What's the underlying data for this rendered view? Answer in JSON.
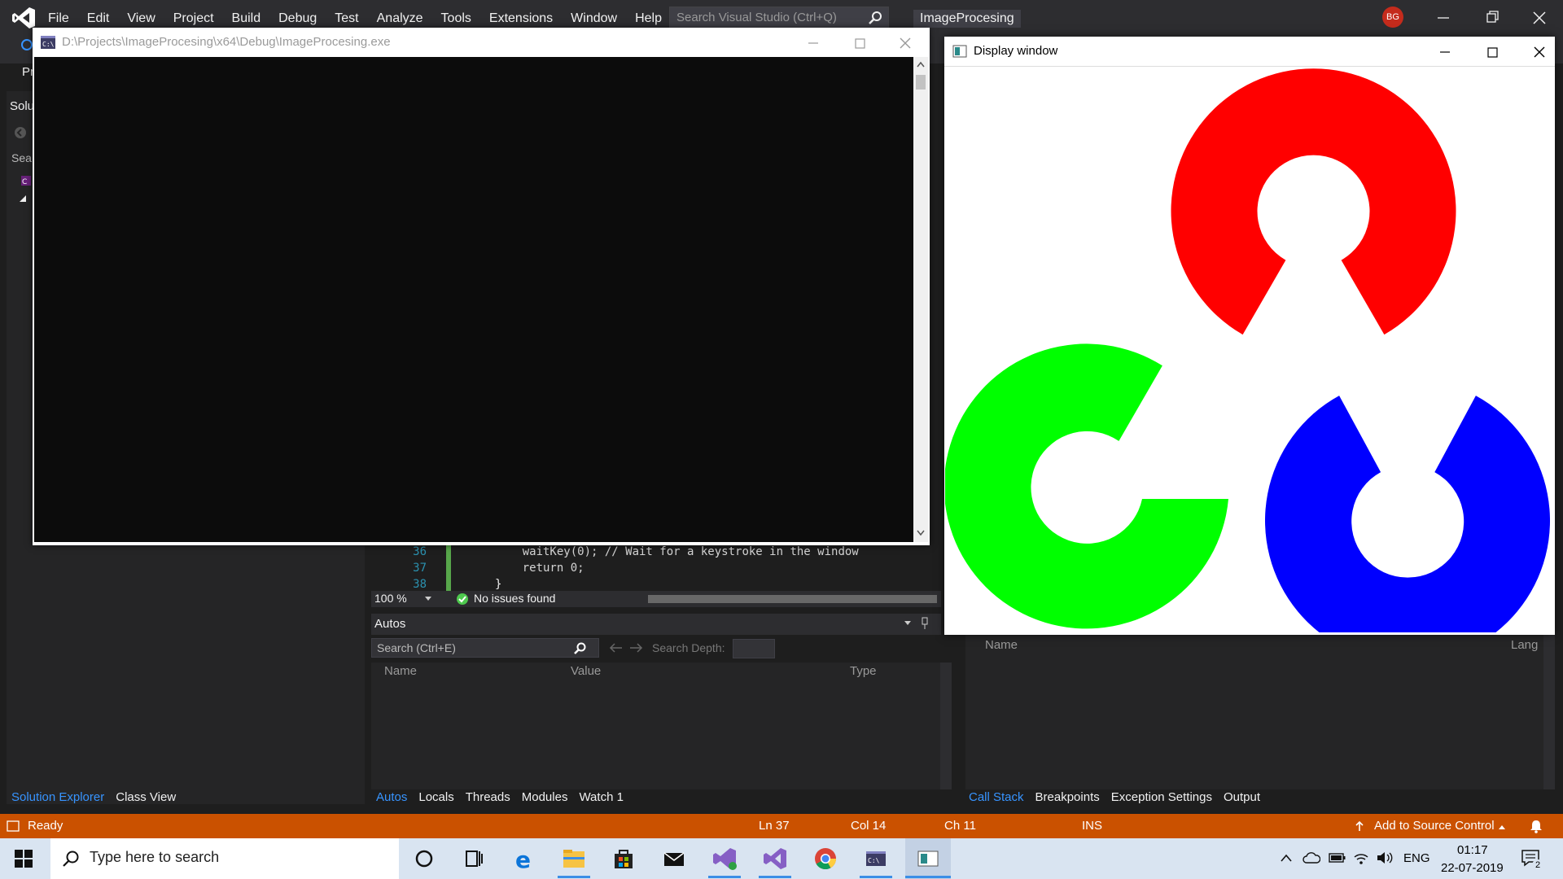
{
  "vs": {
    "menu": [
      "File",
      "Edit",
      "View",
      "Project",
      "Build",
      "Debug",
      "Test",
      "Analyze",
      "Tools",
      "Extensions",
      "Window",
      "Help"
    ],
    "search_placeholder": "Search Visual Studio (Ctrl+Q)",
    "project_title": "ImageProcesing",
    "avatar_initials": "BG",
    "toolbar_start_fragment": "Pr",
    "solution_explorer_head": "Solu",
    "solution_search_fragment": "Sea",
    "left_tabs": [
      "Solution Explorer",
      "Class View"
    ],
    "editor": {
      "lines": [
        {
          "num": "36",
          "code": "waitKey(0); // Wait for a keystroke in the window"
        },
        {
          "num": "37",
          "code": "return 0;"
        },
        {
          "num": "38",
          "code": "}"
        }
      ],
      "zoom": "100 %",
      "issues": "No issues found"
    },
    "autos": {
      "title": "Autos",
      "search_placeholder": "Search (Ctrl+E)",
      "search_depth_label": "Search Depth:",
      "columns": [
        "Name",
        "Value",
        "Type"
      ],
      "tabs": [
        "Autos",
        "Locals",
        "Threads",
        "Modules",
        "Watch 1"
      ]
    },
    "right_panel": {
      "columns": [
        "Name",
        "Lang"
      ],
      "tabs": [
        "Call Stack",
        "Breakpoints",
        "Exception Settings",
        "Output"
      ]
    },
    "status": {
      "state": "Ready",
      "ln": "Ln 37",
      "col": "Col 14",
      "ch": "Ch 11",
      "mode": "INS",
      "source_control": "Add to Source Control"
    }
  },
  "console": {
    "title": "D:\\Projects\\ImageProcesing\\x64\\Debug\\ImageProcesing.exe"
  },
  "display_window": {
    "title": "Display window",
    "colors": {
      "red": "#ff0000",
      "green": "#00ff00",
      "blue": "#0000ff"
    }
  },
  "taskbar": {
    "search_placeholder": "Type here to search",
    "language": "ENG",
    "time": "01:17",
    "date": "22-07-2019",
    "notification_count": "2",
    "apps": [
      "cortana-icon",
      "task-view-icon",
      "edge-icon",
      "file-explorer-icon",
      "store-icon",
      "mail-icon",
      "visual-studio-installer-icon",
      "visual-studio-icon",
      "chrome-icon",
      "console-app-icon",
      "display-window-app-icon"
    ]
  }
}
